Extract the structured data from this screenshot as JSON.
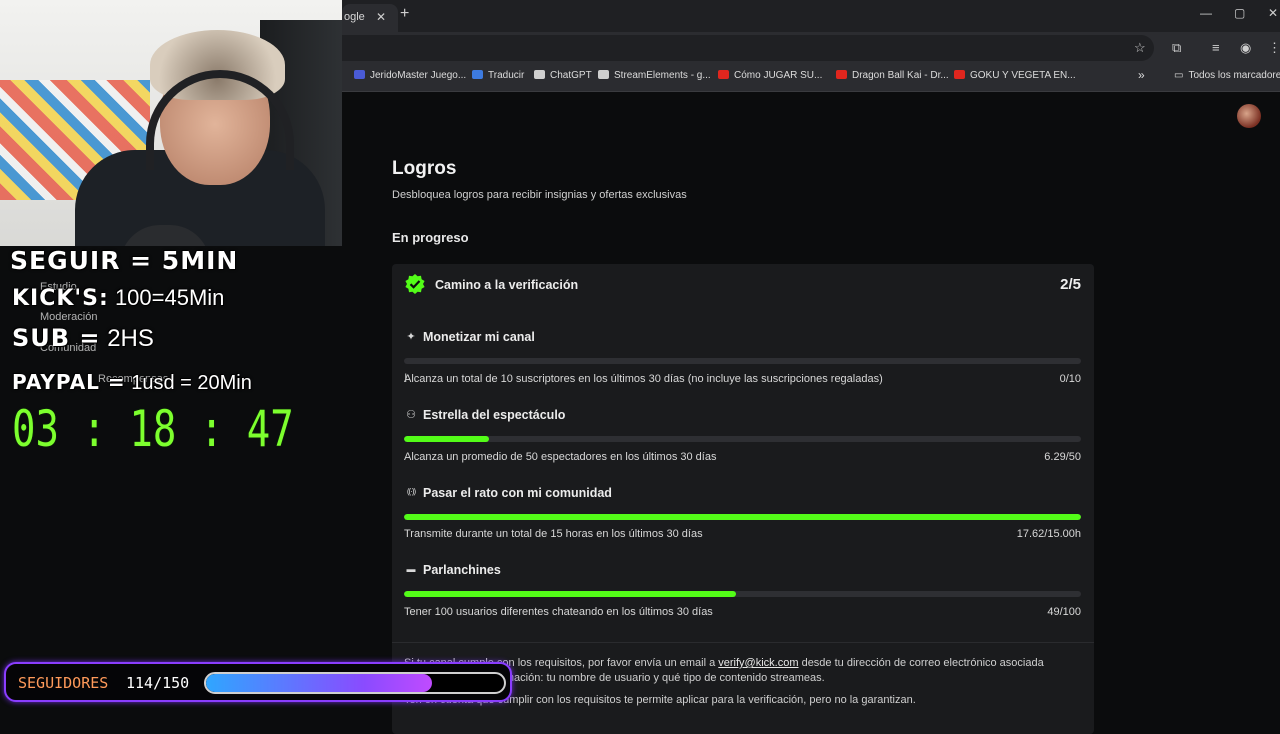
{
  "browser": {
    "tab_title": "ogle",
    "tab_close": "✕",
    "new_tab": "+",
    "window_controls": [
      "—",
      "▢",
      "✕"
    ],
    "toolbar_icons": [
      "star-icon",
      "extensions-icon",
      "media-icon",
      "extension-icon",
      "menu-icon"
    ],
    "bookmarks": [
      {
        "label": "JeridoMaster Juego...",
        "color": "#4a5bd6"
      },
      {
        "label": "Traducir",
        "color": "#3d7be0"
      },
      {
        "label": "ChatGPT",
        "color": "#cfcfcf"
      },
      {
        "label": "StreamElements - g...",
        "color": "#cfcfcf"
      },
      {
        "label": "Cómo JUGAR SU...",
        "color": "#e0261e"
      },
      {
        "label": "Dragon Ball Kai - Dr...",
        "color": "#e0261e"
      },
      {
        "label": "GOKU Y VEGETA EN...",
        "color": "#e0261e"
      }
    ],
    "bookmarks_more": "»",
    "all_bookmarks": "Todos los marcadores"
  },
  "page": {
    "title": "Logros",
    "subtitle": "Desbloquea logros para recibir insignias y ofertas exclusivas",
    "section_heading": "En progreso",
    "card": {
      "title": "Camino a la verificación",
      "count": "2/5",
      "achievements": [
        {
          "icon": "✦",
          "icon_name": "sparkle-icon",
          "title": "Monetizar mi canal",
          "description": "Alcanza un total de 10 suscriptores en los últimos 30 días (no incluye las suscripciones regaladas)",
          "value": "0/10",
          "progress": 0.0
        },
        {
          "icon": "⚇",
          "icon_name": "viewers-icon",
          "title": "Estrella del espectáculo",
          "description": "Alcanza un promedio de 50 espectadores en los últimos 30 días",
          "value": "6.29/50",
          "progress": 0.126
        },
        {
          "icon": "((·))",
          "icon_name": "broadcast-icon",
          "title": "Pasar el rato con mi comunidad",
          "description": "Transmite durante un total de 15 horas en los últimos 30 días",
          "value": "17.62/15.00h",
          "progress": 1.0
        },
        {
          "icon": "▬",
          "icon_name": "chat-icon",
          "title": "Parlanchines",
          "description": "Tener 100 usuarios diferentes chateando en los últimos 30 días",
          "value": "49/100",
          "progress": 0.49
        }
      ]
    },
    "note_line1_prefix": "Si tu canal cumple con los requisitos, por favor envía un email a ",
    "note_email": "verify@kick.com",
    "note_line1_suffix": " desde tu dirección de correo electrónico asociada",
    "note_line2": "con la siguiente información: tu nombre de usuario y qué tipo de contenido streameas.",
    "note_line3": "Ten en cuenta que cumplir con los requisitos te permite aplicar para la verificación, pero no la garantizan."
  },
  "overlay": {
    "seguir": "SEGUIR = 5MIN",
    "kicks_label": "KICK'S:",
    "kicks_value": "100=45Min",
    "sub_label": "SUB =",
    "sub_value": "2HS",
    "paypal_label": "PAYPAL =",
    "paypal_value": "1usd = 20Min",
    "ghost_items": [
      "Estudio",
      "Moderación",
      "Comunidad",
      "Recompensas"
    ],
    "timer": "03 : 18 : 47",
    "followers_label": "SEGUIDORES",
    "followers_count": "114/150",
    "followers_progress": 0.76
  }
}
